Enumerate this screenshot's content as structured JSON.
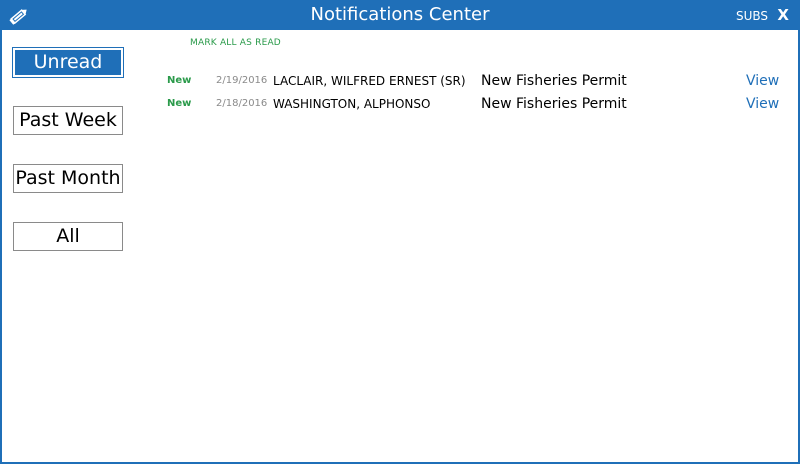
{
  "window": {
    "title": "Notifications Center",
    "subs_label": "SUBS",
    "close_label": "X",
    "accent_color": "#1f6fb8",
    "icons": {
      "edit": "pencil-icon"
    }
  },
  "filters": [
    {
      "label": "Unread",
      "active": true
    },
    {
      "label": "Past Week",
      "active": false
    },
    {
      "label": "Past Month",
      "active": false
    },
    {
      "label": "All",
      "active": false
    }
  ],
  "actions": {
    "mark_all_read": "MARK ALL AS READ"
  },
  "notifications": [
    {
      "status": "New",
      "date": "2/19/2016",
      "name": "LACLAIR, WILFRED ERNEST (SR)",
      "type": "New Fisheries Permit",
      "action": "View"
    },
    {
      "status": "New",
      "date": "2/18/2016",
      "name": "WASHINGTON, ALPHONSO",
      "type": "New Fisheries Permit",
      "action": "View"
    }
  ],
  "colors": {
    "status_new": "#2a9a4a",
    "link": "#1f6fb8",
    "date": "#8a8a8a"
  }
}
